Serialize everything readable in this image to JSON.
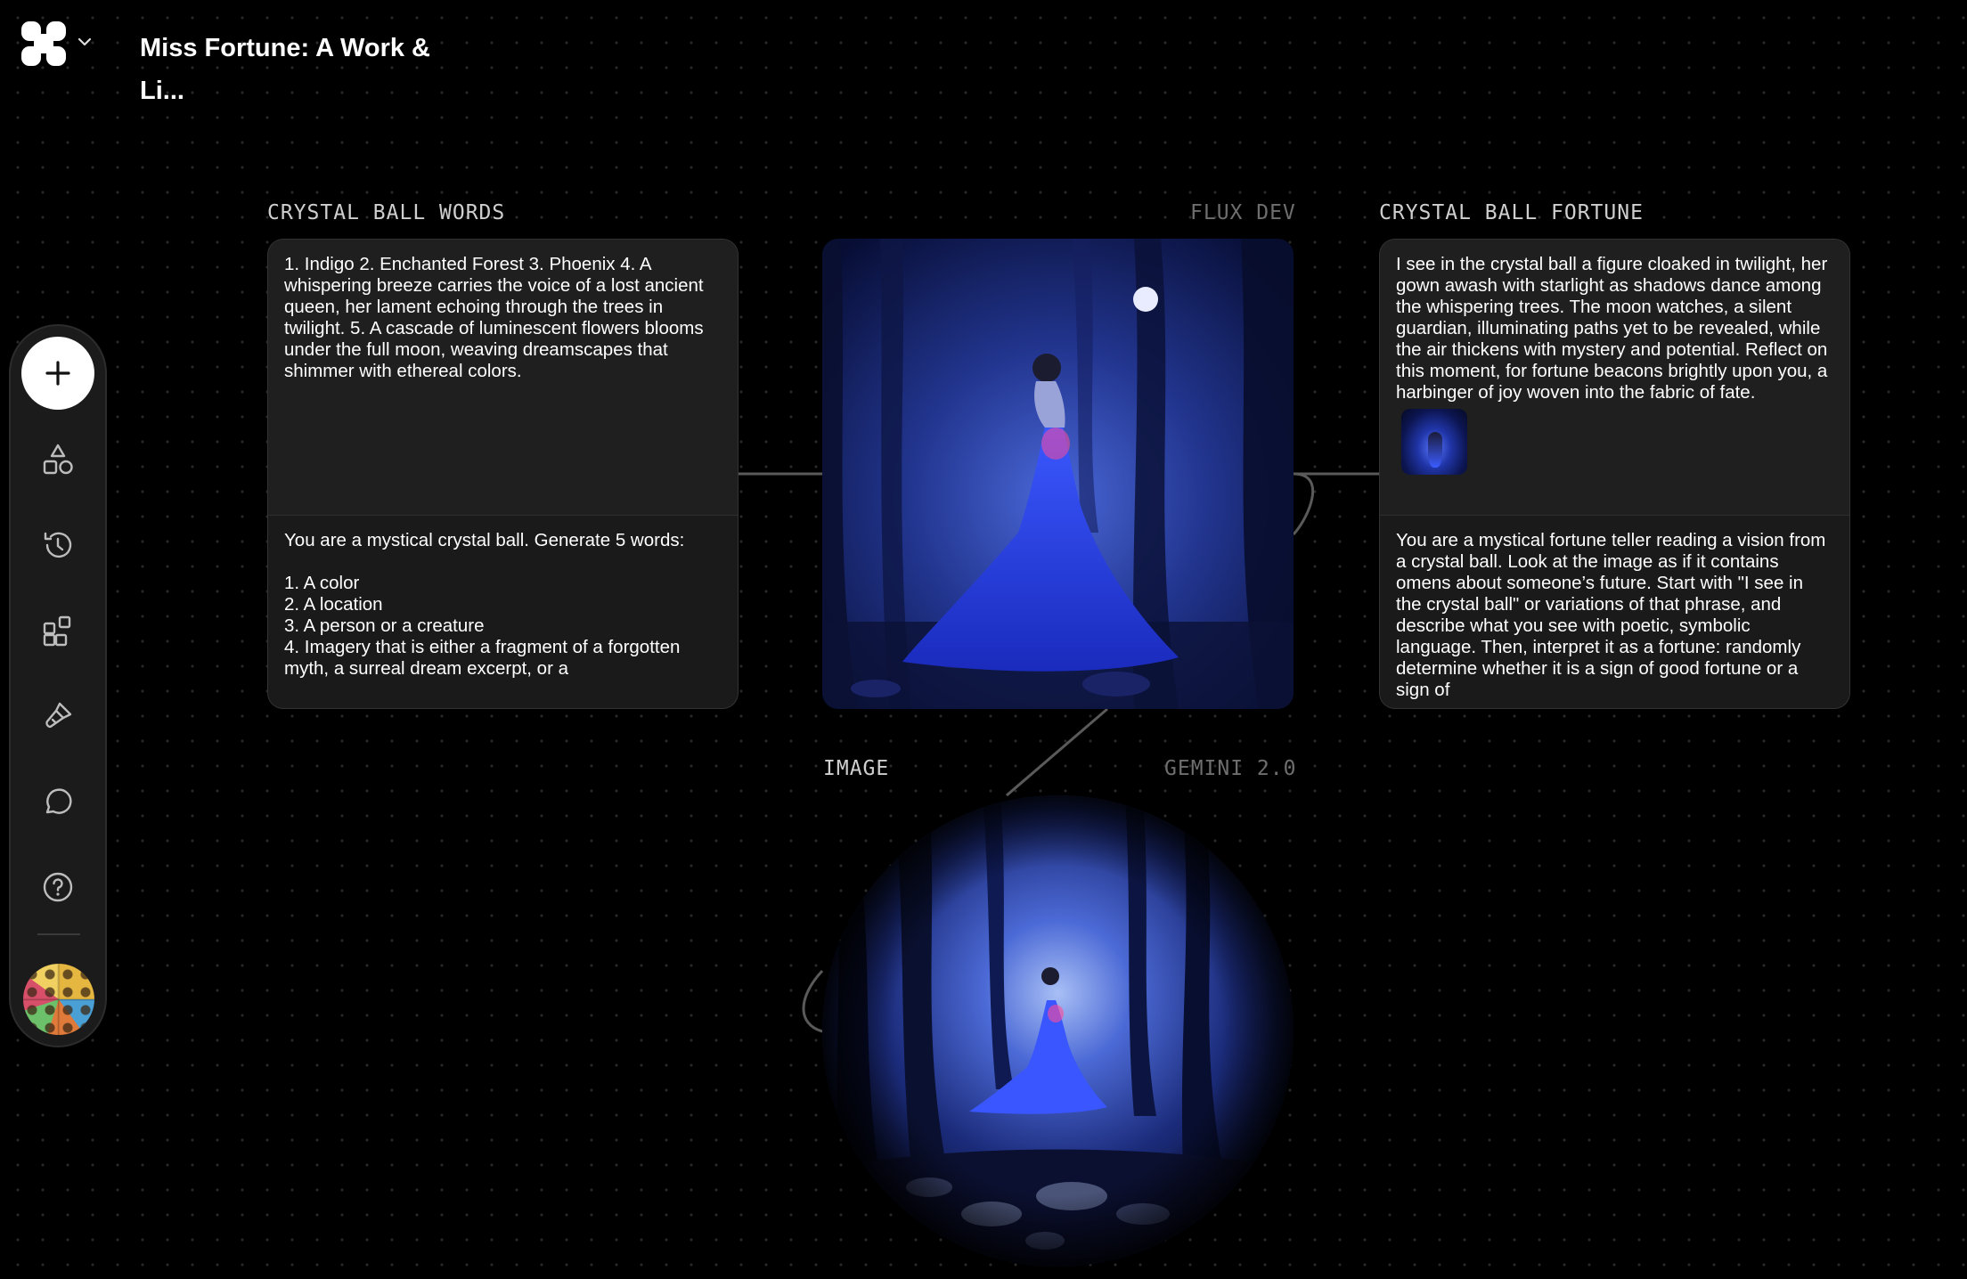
{
  "header": {
    "project_title": "Miss Fortune: A Work & Li..."
  },
  "toolbar": {
    "items": [
      "add",
      "shapes",
      "history",
      "widgets",
      "brush",
      "chat",
      "help"
    ]
  },
  "nodes": {
    "crystal_ball_words": {
      "label": "CRYSTAL BALL WORDS",
      "output": "1. Indigo 2. Enchanted Forest 3. Phoenix 4. A whispering breeze carries the voice of a lost ancient queen, her lament echoing through the trees in twilight. 5. A cascade of luminescent flowers blooms under the full moon, weaving dreamscapes that shimmer with ethereal colors.",
      "prompt": "You are a mystical crystal ball. Generate 5 words:\n\n1. A color\n2. A location\n3. A person or a creature\n4. Imagery that is either a fragment of a forgotten myth, a surreal dream excerpt, or a"
    },
    "flux_dev": {
      "label": "FLUX DEV"
    },
    "crystal_ball_fortune": {
      "label": "CRYSTAL BALL FORTUNE",
      "output": "I see in the crystal ball a figure cloaked in twilight, her gown awash with starlight as shadows dance among the whispering trees. The moon watches, a silent guardian, illuminating paths yet to be revealed, while the air thickens with mystery and potential. Reflect on this moment, for fortune beacons brightly upon you, a harbinger of joy woven into the fabric of fate.",
      "prompt": "You are a mystical fortune teller reading a vision from a crystal ball. Look at the image as if it contains omens about someone’s future. Start with \"I see in the crystal ball\" or variations of that phrase, and describe what you see with poetic, symbolic language. Then, interpret it as a fortune: randomly determine whether it is a sign of good fortune or a sign of"
    },
    "image": {
      "label": "IMAGE",
      "model": "GEMINI 2.0"
    }
  },
  "colors": {
    "background": "#000000",
    "node_bg": "#1d1d1d",
    "accent_blue": "#3a55ff"
  }
}
